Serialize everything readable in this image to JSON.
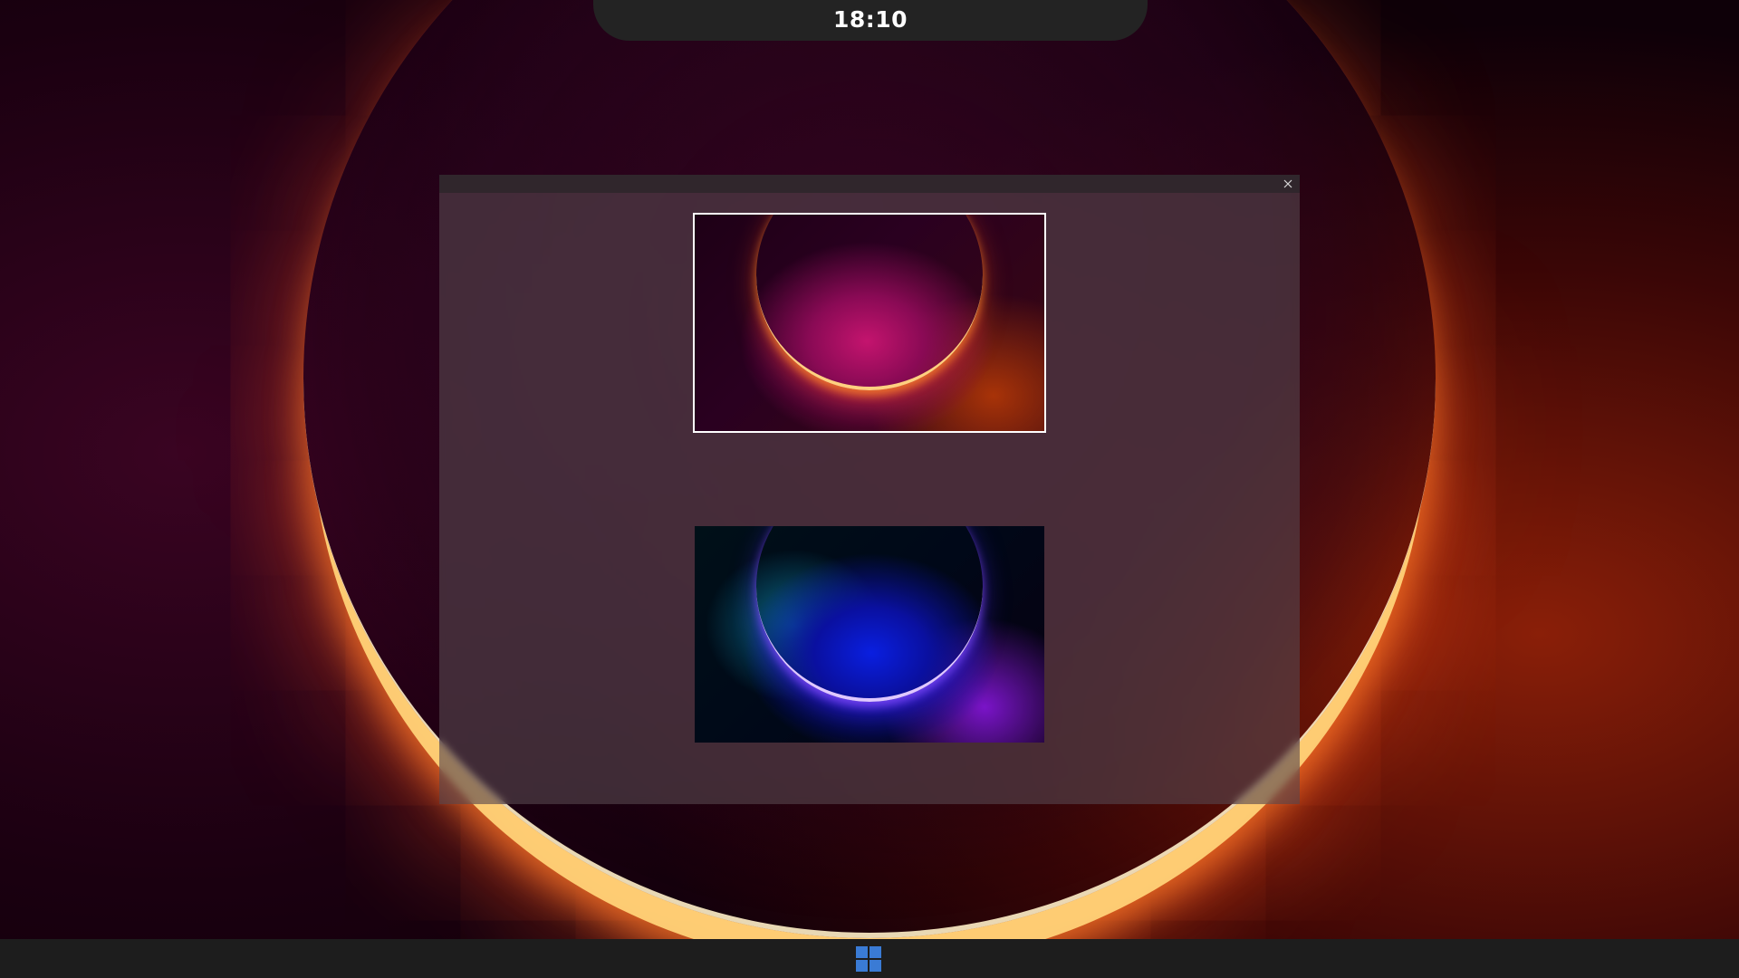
{
  "clock": {
    "time": "18:10"
  },
  "dialog": {
    "close_icon": "close-icon",
    "wallpapers": [
      {
        "name": "wallpaper-red-arc",
        "selected": true,
        "accent": "#c4146e"
      },
      {
        "name": "wallpaper-blue-arc",
        "selected": false,
        "accent": "#0a1fe0"
      }
    ]
  },
  "taskbar": {
    "start_icon": "windows-logo-icon",
    "start_color": "#3a7bd5"
  },
  "colors": {
    "wallpaper_glow": "#ff6a20",
    "dialog_bg": "#55464e",
    "clock_bar": "#232323",
    "taskbar": "#1d1d1d"
  }
}
